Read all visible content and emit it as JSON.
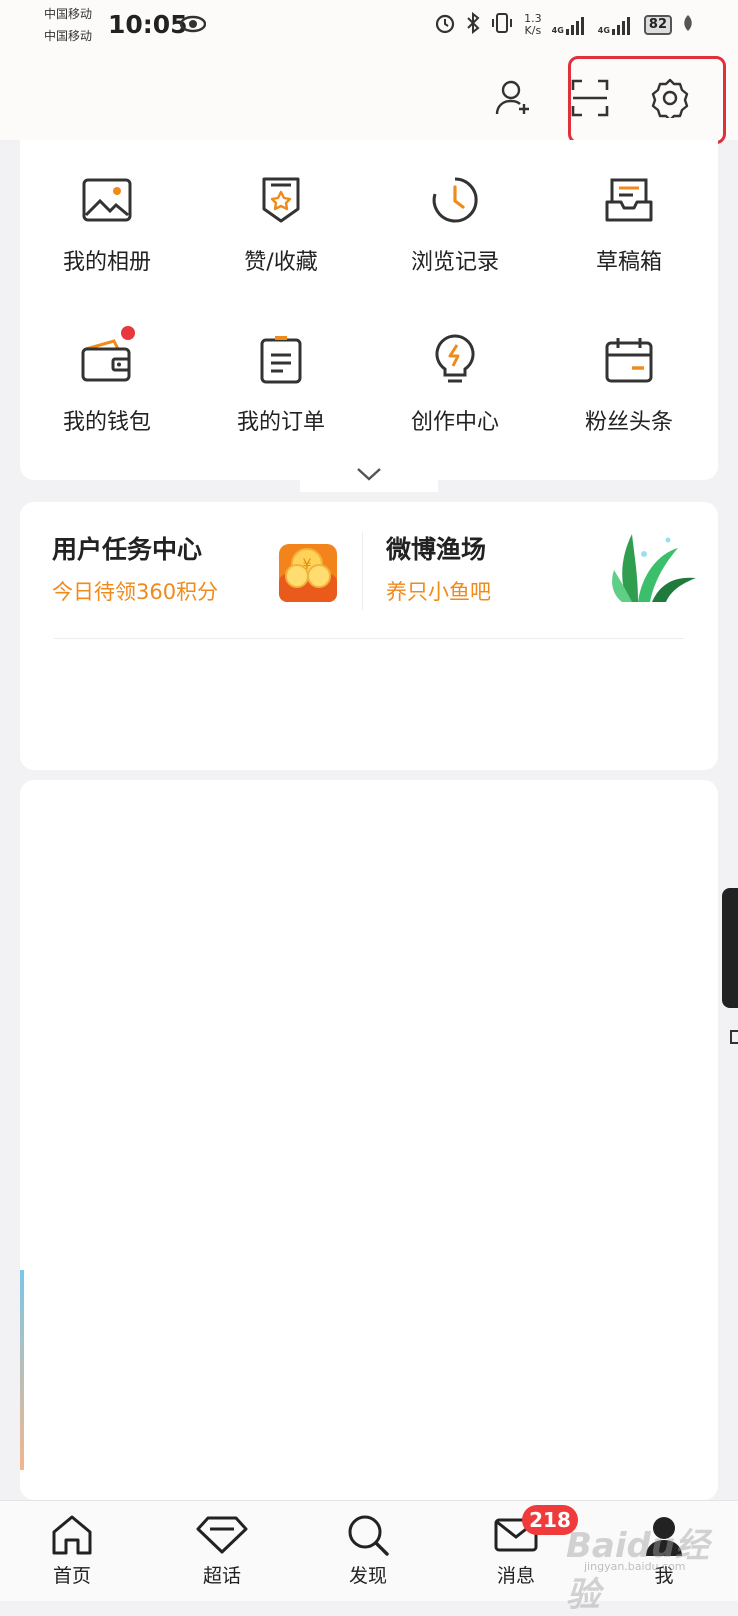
{
  "status_bar": {
    "carrier1": "中国移动",
    "carrier2": "中国移动",
    "time": "10:05",
    "net_speed_value": "1.3",
    "net_speed_unit": "K/s",
    "signal1_label": "4G",
    "signal2_label": "4G",
    "battery": "82"
  },
  "header": {
    "icons": [
      "add-user-icon",
      "scan-icon",
      "settings-icon"
    ]
  },
  "menu": {
    "items": [
      {
        "label": "我的相册",
        "icon": "photo-album-icon"
      },
      {
        "label": "赞/收藏",
        "icon": "likes-favorites-icon"
      },
      {
        "label": "浏览记录",
        "icon": "history-clock-icon"
      },
      {
        "label": "草稿箱",
        "icon": "drafts-box-icon"
      },
      {
        "label": "我的钱包",
        "icon": "wallet-icon"
      },
      {
        "label": "我的订单",
        "icon": "orders-icon"
      },
      {
        "label": "创作中心",
        "icon": "creator-bulb-icon"
      },
      {
        "label": "粉丝头条",
        "icon": "calendar-icon"
      }
    ]
  },
  "tasks": {
    "left": {
      "title": "用户任务中心",
      "subtitle": "今日待领360积分"
    },
    "right": {
      "title": "微博渔场",
      "subtitle": "养只小鱼吧"
    }
  },
  "bottom_nav": {
    "items": [
      {
        "label": "首页",
        "icon": "home-icon"
      },
      {
        "label": "超话",
        "icon": "diamond-icon"
      },
      {
        "label": "发现",
        "icon": "search-icon"
      },
      {
        "label": "消息",
        "icon": "mail-icon"
      },
      {
        "label": "我",
        "icon": "profile-icon"
      }
    ],
    "message_badge": "218"
  },
  "watermark": {
    "logo": "Baidu经验",
    "url": "jingyan.baidu.com"
  },
  "colors": {
    "accent_orange": "#f08a1a",
    "highlight_red": "#e0303c",
    "badge_red": "#ef3b3b"
  }
}
